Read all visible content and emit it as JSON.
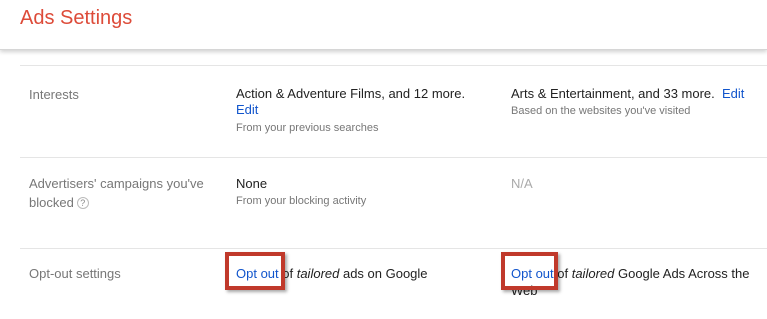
{
  "header": {
    "title": "Ads Settings"
  },
  "rows": {
    "interests": {
      "label": "Interests",
      "search": {
        "text": "Action & Adventure Films, and 12 more.",
        "edit_label": "Edit",
        "sub": "From your previous searches"
      },
      "web": {
        "text": "Arts & Entertainment, and 33 more.",
        "edit_label": "Edit",
        "sub": "Based on the websites you've visited"
      }
    },
    "blocked": {
      "label": "Advertisers' campaigns you've blocked",
      "help_icon": "?",
      "search": {
        "text": "None",
        "sub": "From your blocking activity"
      },
      "web": {
        "text": "N/A"
      }
    },
    "optout": {
      "label": "Opt-out settings",
      "search": {
        "link": "Opt out",
        "pre": " of ",
        "em": "tailored",
        "post": " ads on Google"
      },
      "web": {
        "link": "Opt out",
        "pre": " of ",
        "em": "tailored",
        "post": " Google Ads Across the Web"
      }
    }
  },
  "colors": {
    "title": "#dd4b39",
    "link": "#1155cc",
    "highlight": "#c0392b"
  }
}
